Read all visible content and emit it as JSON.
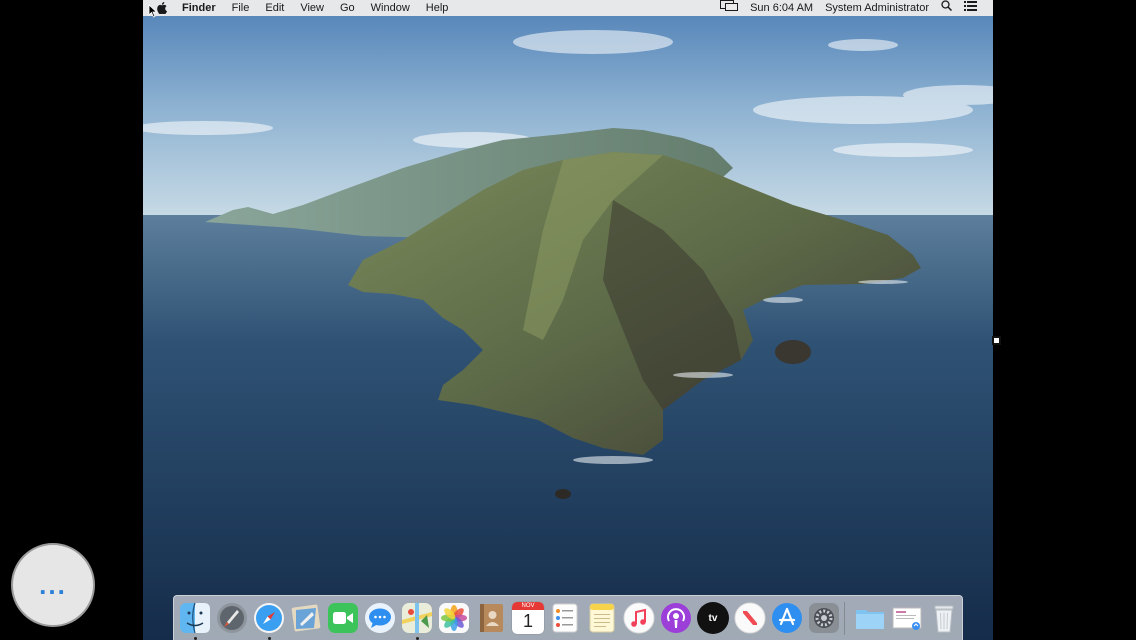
{
  "menubar": {
    "app_name": "Finder",
    "menus": [
      "File",
      "Edit",
      "View",
      "Go",
      "Window",
      "Help"
    ],
    "clock": "Sun 6:04 AM",
    "user": "System Administrator"
  },
  "dock": {
    "apps": [
      "Finder",
      "Launchpad",
      "Safari",
      "Mail",
      "FaceTime",
      "Messages",
      "Maps",
      "Photos",
      "Contacts",
      "Calendar",
      "Reminders",
      "Notes",
      "Music",
      "Podcasts",
      "TV",
      "News",
      "App Store",
      "System Preferences"
    ],
    "calendar_month": "NOV",
    "calendar_day": "1",
    "tv_label": "tv",
    "stack_items": [
      "Downloads folder",
      "Document preview",
      "Trash"
    ]
  },
  "overlay": {
    "more_label": "..."
  },
  "colors": {
    "menubar_bg": "#ececec",
    "overlay_accent": "#2b7fd6"
  }
}
